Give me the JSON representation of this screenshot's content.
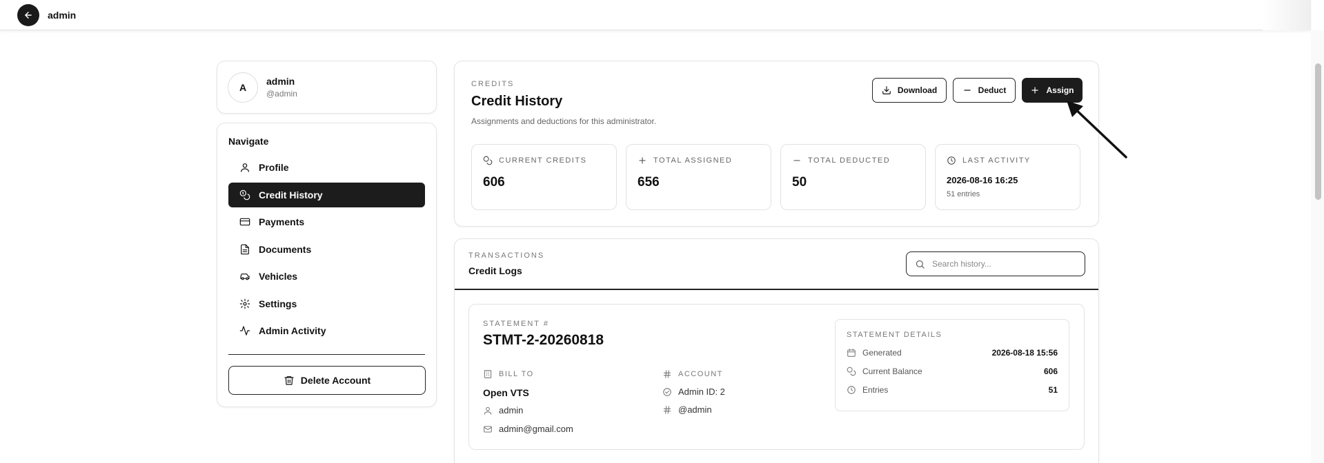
{
  "topbar": {
    "title": "admin"
  },
  "profile": {
    "initial": "A",
    "name": "admin",
    "handle": "@admin"
  },
  "nav": {
    "heading": "Navigate",
    "items": [
      {
        "label": "Profile",
        "icon": "user-icon"
      },
      {
        "label": "Credit History",
        "icon": "coins-icon",
        "active": true
      },
      {
        "label": "Payments",
        "icon": "credit-card-icon"
      },
      {
        "label": "Documents",
        "icon": "file-text-icon"
      },
      {
        "label": "Vehicles",
        "icon": "car-icon"
      },
      {
        "label": "Settings",
        "icon": "gear-icon"
      },
      {
        "label": "Admin Activity",
        "icon": "activity-icon"
      }
    ],
    "delete_label": "Delete Account"
  },
  "credits": {
    "eyebrow": "CREDITS",
    "title": "Credit History",
    "subtitle": "Assignments and deductions for this administrator.",
    "buttons": {
      "download": "Download",
      "deduct": "Deduct",
      "assign": "Assign"
    },
    "stats": {
      "current": {
        "label": "CURRENT CREDITS",
        "value": "606"
      },
      "assigned": {
        "label": "TOTAL ASSIGNED",
        "value": "656"
      },
      "deducted": {
        "label": "TOTAL DEDUCTED",
        "value": "50"
      },
      "last": {
        "label": "LAST ACTIVITY",
        "value": "2026-08-16 16:25",
        "note": "51 entries"
      }
    }
  },
  "logs": {
    "eyebrow": "TRANSACTIONS",
    "title": "Credit Logs",
    "search_placeholder": "Search history...",
    "statement": {
      "eyebrow": "STATEMENT #",
      "number": "STMT-2-20260818",
      "bill_to_label": "BILL TO",
      "bill_to_name": "Open VTS",
      "bill_to_user": "admin",
      "bill_to_email": "admin@gmail.com",
      "account_label": "ACCOUNT",
      "account_id": "Admin ID: 2",
      "account_handle": "@admin",
      "details": {
        "eyebrow": "STATEMENT DETAILS",
        "generated_label": "Generated",
        "generated_value": "2026-08-18 15:56",
        "balance_label": "Current Balance",
        "balance_value": "606",
        "entries_label": "Entries",
        "entries_value": "51"
      }
    }
  },
  "colors": {
    "primary": "#1c1c1c",
    "border": "#e4e4e4",
    "muted": "#777777"
  }
}
